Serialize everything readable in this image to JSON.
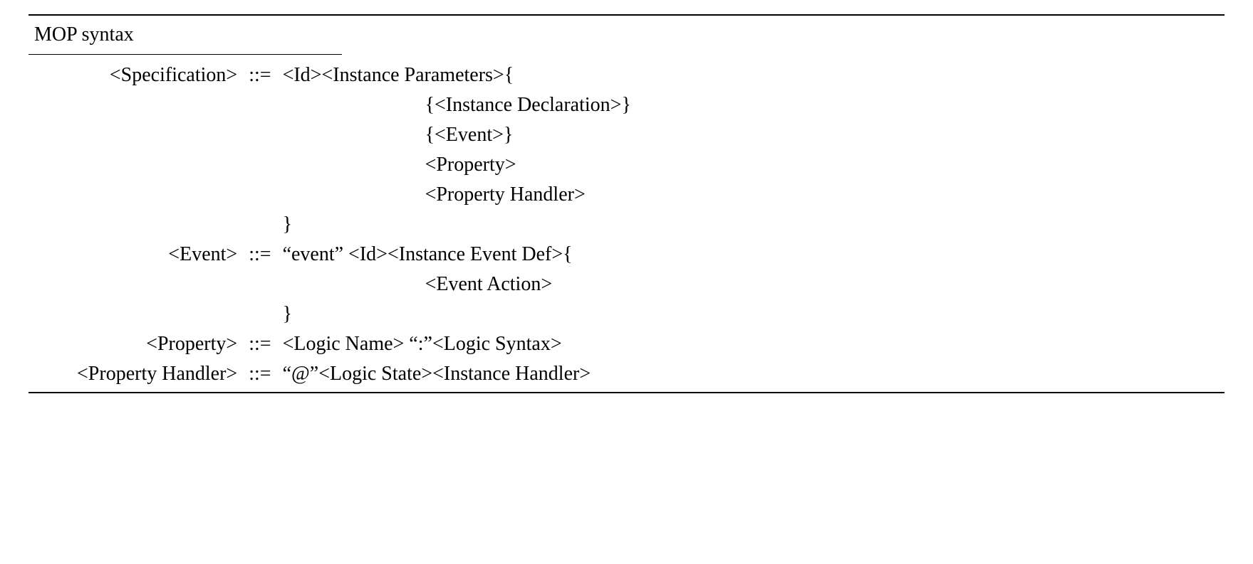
{
  "title": "MOP syntax",
  "op": "::=",
  "rules": {
    "spec": {
      "lhs": "<Specification>",
      "r1": "<Id><Instance Parameters>{",
      "r2": "{<Instance Declaration>}",
      "r3": "{<Event>}",
      "r4": "<Property>",
      "r5": "<Property Handler>",
      "r6": "}"
    },
    "event": {
      "lhs": "<Event>",
      "r1": "“event” <Id><Instance Event Def>{",
      "r2": "<Event Action>",
      "r3": "}"
    },
    "property": {
      "lhs": "<Property>",
      "r1": "<Logic Name> “:”<Logic Syntax>"
    },
    "prophandler": {
      "lhs": "<Property Handler>",
      "r1": "“@”<Logic State><Instance Handler>"
    }
  }
}
